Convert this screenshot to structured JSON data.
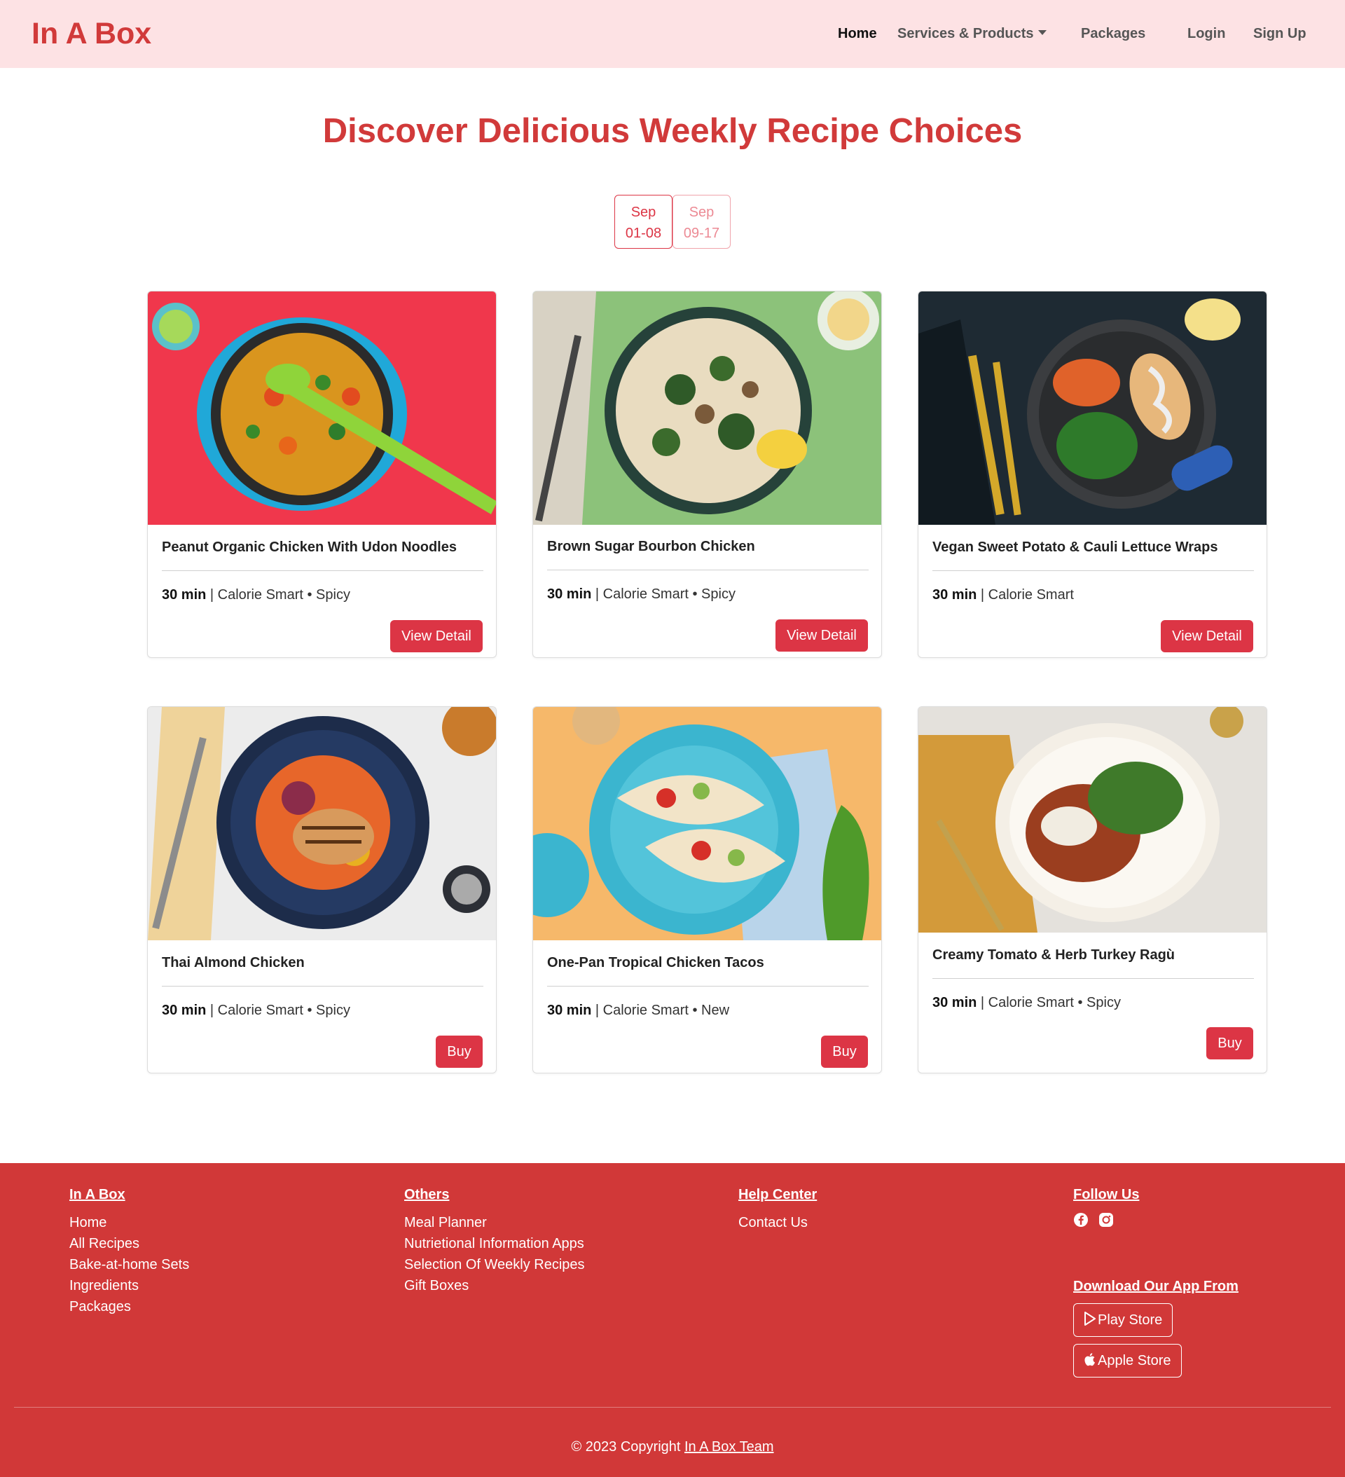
{
  "brand": "In A Box",
  "nav": {
    "home": "Home",
    "services": "Services & Products",
    "packages": "Packages",
    "login": "Login",
    "signup": "Sign Up"
  },
  "page_title": "Discover Delicious Weekly Recipe Choices",
  "weeks": [
    {
      "month": "Sep",
      "range": "01-08",
      "active": true
    },
    {
      "month": "Sep",
      "range": "09-17",
      "active": false
    }
  ],
  "recipes": [
    {
      "title": "Peanut Organic Chicken With Udon Noodles",
      "time": "30 min",
      "tags": "| Calorie Smart • Spicy",
      "action": "View Detail"
    },
    {
      "title": "Brown Sugar Bourbon Chicken",
      "time": "30 min",
      "tags": "| Calorie Smart • Spicy",
      "action": "View Detail"
    },
    {
      "title": "Vegan Sweet Potato & Cauli Lettuce Wraps",
      "time": "30 min",
      "tags": "| Calorie Smart",
      "action": "View Detail"
    },
    {
      "title": "Thai Almond Chicken",
      "time": "30 min",
      "tags": "| Calorie Smart • Spicy",
      "action": "Buy"
    },
    {
      "title": "One-Pan Tropical Chicken Tacos",
      "time": "30 min",
      "tags": "| Calorie Smart • New",
      "action": "Buy"
    },
    {
      "title": "Creamy Tomato & Herb Turkey Ragù",
      "time": "30 min",
      "tags": "| Calorie Smart • Spicy",
      "action": "Buy"
    }
  ],
  "footer": {
    "col1": {
      "heading": "In A Box",
      "links": [
        "Home",
        "All Recipes",
        "Bake-at-home Sets",
        "Ingredients",
        "Packages"
      ]
    },
    "col2": {
      "heading": "Others",
      "links": [
        "Meal Planner",
        "Nutrietional Information Apps",
        "Selection Of Weekly Recipes",
        "Gift Boxes"
      ]
    },
    "col3": {
      "heading": "Help Center",
      "links": [
        "Contact Us"
      ]
    },
    "follow": {
      "heading": "Follow Us"
    },
    "download": {
      "heading": "Download Our App From",
      "play": "Play Store",
      "apple": "Apple Store"
    },
    "copyright_prefix": "© 2023 Copyright",
    "copyright_link": "In A Box Team"
  },
  "colors": {
    "brand_red": "#d13a3a",
    "button_red": "#dc3545",
    "nav_bg": "#fde2e4",
    "footer_bg": "#d13838"
  },
  "icons": [
    "caret-down-icon",
    "facebook-icon",
    "instagram-icon",
    "play-icon",
    "apple-icon"
  ]
}
